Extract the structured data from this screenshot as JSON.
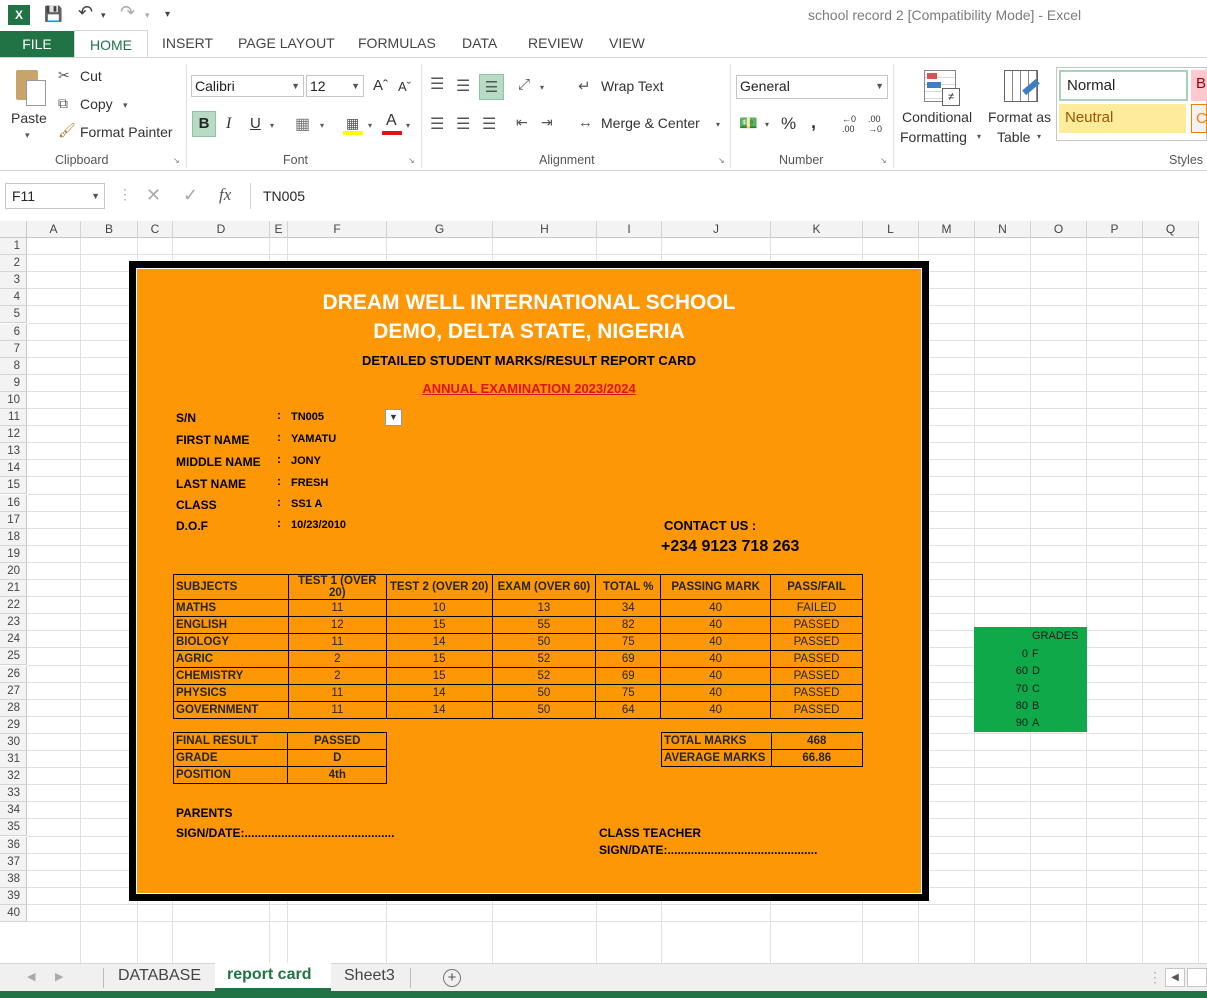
{
  "window": {
    "title": "school record 2  [Compatibility Mode] - Excel"
  },
  "ribbon_tabs": {
    "file": "FILE",
    "home": "HOME",
    "insert": "INSERT",
    "page_layout": "PAGE LAYOUT",
    "formulas": "FORMULAS",
    "data": "DATA",
    "review": "REVIEW",
    "view": "VIEW"
  },
  "clipboard": {
    "paste": "Paste",
    "cut": "Cut",
    "copy": "Copy",
    "format_painter": "Format Painter",
    "label": "Clipboard"
  },
  "font": {
    "name": "Calibri",
    "size": "12",
    "label": "Font",
    "bold": "B",
    "italic": "I",
    "underline": "U"
  },
  "alignment": {
    "wrap_text": "Wrap Text",
    "merge_center": "Merge & Center",
    "label": "Alignment"
  },
  "number": {
    "format": "General",
    "label": "Number",
    "percent": "%",
    "comma": ","
  },
  "styles": {
    "conditional": "Conditional",
    "formatting": "Formatting",
    "format_as": "Format as",
    "table": "Table",
    "normal": "Normal",
    "neutral": "Neutral",
    "bad_cut": "B",
    "calc_cut": "C",
    "label": "Styles"
  },
  "formula_bar": {
    "name_box": "F11",
    "content": "TN005",
    "fx": "fx"
  },
  "columns": [
    "A",
    "B",
    "C",
    "D",
    "E",
    "F",
    "G",
    "H",
    "I",
    "J",
    "K",
    "L",
    "M",
    "N",
    "O",
    "P",
    "Q"
  ],
  "rows": [
    "1",
    "2",
    "3",
    "4",
    "5",
    "6",
    "7",
    "8",
    "9",
    "10",
    "11",
    "12",
    "13",
    "14",
    "15",
    "16",
    "17",
    "18",
    "19",
    "20",
    "21",
    "22",
    "23",
    "24",
    "25",
    "26",
    "27",
    "28",
    "29",
    "30",
    "31",
    "32",
    "33",
    "34",
    "35",
    "36",
    "37",
    "38",
    "39",
    "40"
  ],
  "card": {
    "school": "DREAM WELL  INTERNATIONAL SCHOOL",
    "location": "DEMO, DELTA STATE, NIGERIA",
    "subtitle": "DETAILED STUDENT MARKS/RESULT REPORT CARD",
    "exam": "ANNUAL EXAMINATION 2023/2024",
    "info": [
      {
        "label": "S/N",
        "value": "TN005"
      },
      {
        "label": "FIRST NAME",
        "value": "YAMATU"
      },
      {
        "label": "MIDDLE NAME",
        "value": "JONY"
      },
      {
        "label": "LAST NAME",
        "value": "FRESH"
      },
      {
        "label": "CLASS",
        "value": "SS1 A"
      },
      {
        "label": "D.O.F",
        "value": "10/23/2010"
      }
    ],
    "colon": ":",
    "contact_label": "CONTACT US :",
    "contact_phone": "+234 9123 718 263",
    "table_headers": [
      "SUBJECTS",
      "TEST 1 (OVER 20)",
      "TEST 2 (OVER 20)",
      "EXAM (OVER 60)",
      "TOTAL %",
      "PASSING MARK",
      "PASS/FAIL"
    ],
    "subjects": [
      [
        "MATHS",
        "11",
        "10",
        "13",
        "34",
        "40",
        "FAILED"
      ],
      [
        "ENGLISH",
        "12",
        "15",
        "55",
        "82",
        "40",
        "PASSED"
      ],
      [
        "BIOLOGY",
        "11",
        "14",
        "50",
        "75",
        "40",
        "PASSED"
      ],
      [
        "AGRIC",
        "2",
        "15",
        "52",
        "69",
        "40",
        "PASSED"
      ],
      [
        "CHEMISTRY",
        "2",
        "15",
        "52",
        "69",
        "40",
        "PASSED"
      ],
      [
        "PHYSICS",
        "11",
        "14",
        "50",
        "75",
        "40",
        "PASSED"
      ],
      [
        "GOVERNMENT",
        "11",
        "14",
        "50",
        "64",
        "40",
        "PASSED"
      ]
    ],
    "summary": [
      {
        "label": "FINAL RESULT",
        "value": "PASSED"
      },
      {
        "label": "GRADE",
        "value": "D"
      },
      {
        "label": "POSITION",
        "value": "4th"
      }
    ],
    "totals": [
      {
        "label": "TOTAL MARKS",
        "value": "468"
      },
      {
        "label": "AVERAGE MARKS",
        "value": "66.86"
      }
    ],
    "parents": "PARENTS",
    "parents_sign": "SIGN/DATE:.............................................",
    "teacher": "CLASS TEACHER",
    "teacher_sign": "SIGN/DATE:............................................."
  },
  "grades": {
    "title": "GRADES",
    "items": [
      {
        "min": "0",
        "grade": "F"
      },
      {
        "min": "60",
        "grade": "D"
      },
      {
        "min": "70",
        "grade": "C"
      },
      {
        "min": "80",
        "grade": "B"
      },
      {
        "min": "90",
        "grade": "A"
      }
    ]
  },
  "sheets": {
    "s1": "DATABASE",
    "s2": "report card",
    "s3": "Sheet3"
  },
  "colors": {
    "excel_green": "#217346",
    "card_orange": "#fd9706",
    "grades_green": "#10a94a",
    "exam_red": "#e0131b"
  }
}
